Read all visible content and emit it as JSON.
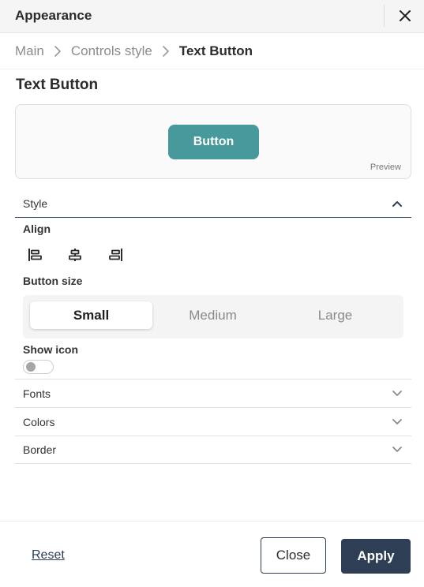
{
  "header": {
    "title": "Appearance",
    "close_icon": "close-icon"
  },
  "breadcrumb": {
    "items": [
      "Main",
      "Controls style",
      "Text Button"
    ],
    "separator_icon": "chevron-right-icon"
  },
  "section": {
    "title": "Text Button"
  },
  "preview": {
    "button_label": "Button",
    "label": "Preview",
    "button_color": "#47999c"
  },
  "style_section": {
    "label": "Style",
    "expanded": true,
    "align": {
      "label": "Align",
      "options": [
        "align-left-icon",
        "align-center-icon",
        "align-right-icon"
      ]
    },
    "button_size": {
      "label": "Button size",
      "options": [
        "Small",
        "Medium",
        "Large"
      ],
      "selected": "Small"
    },
    "show_icon": {
      "label": "Show icon",
      "enabled": false
    }
  },
  "sections": [
    {
      "label": "Fonts",
      "expanded": false
    },
    {
      "label": "Colors",
      "expanded": false
    },
    {
      "label": "Border",
      "expanded": false
    }
  ],
  "footer": {
    "reset_label": "Reset",
    "close_label": "Close",
    "apply_label": "Apply"
  },
  "colors": {
    "primary": "#2e3f55",
    "accent": "#47999c"
  }
}
